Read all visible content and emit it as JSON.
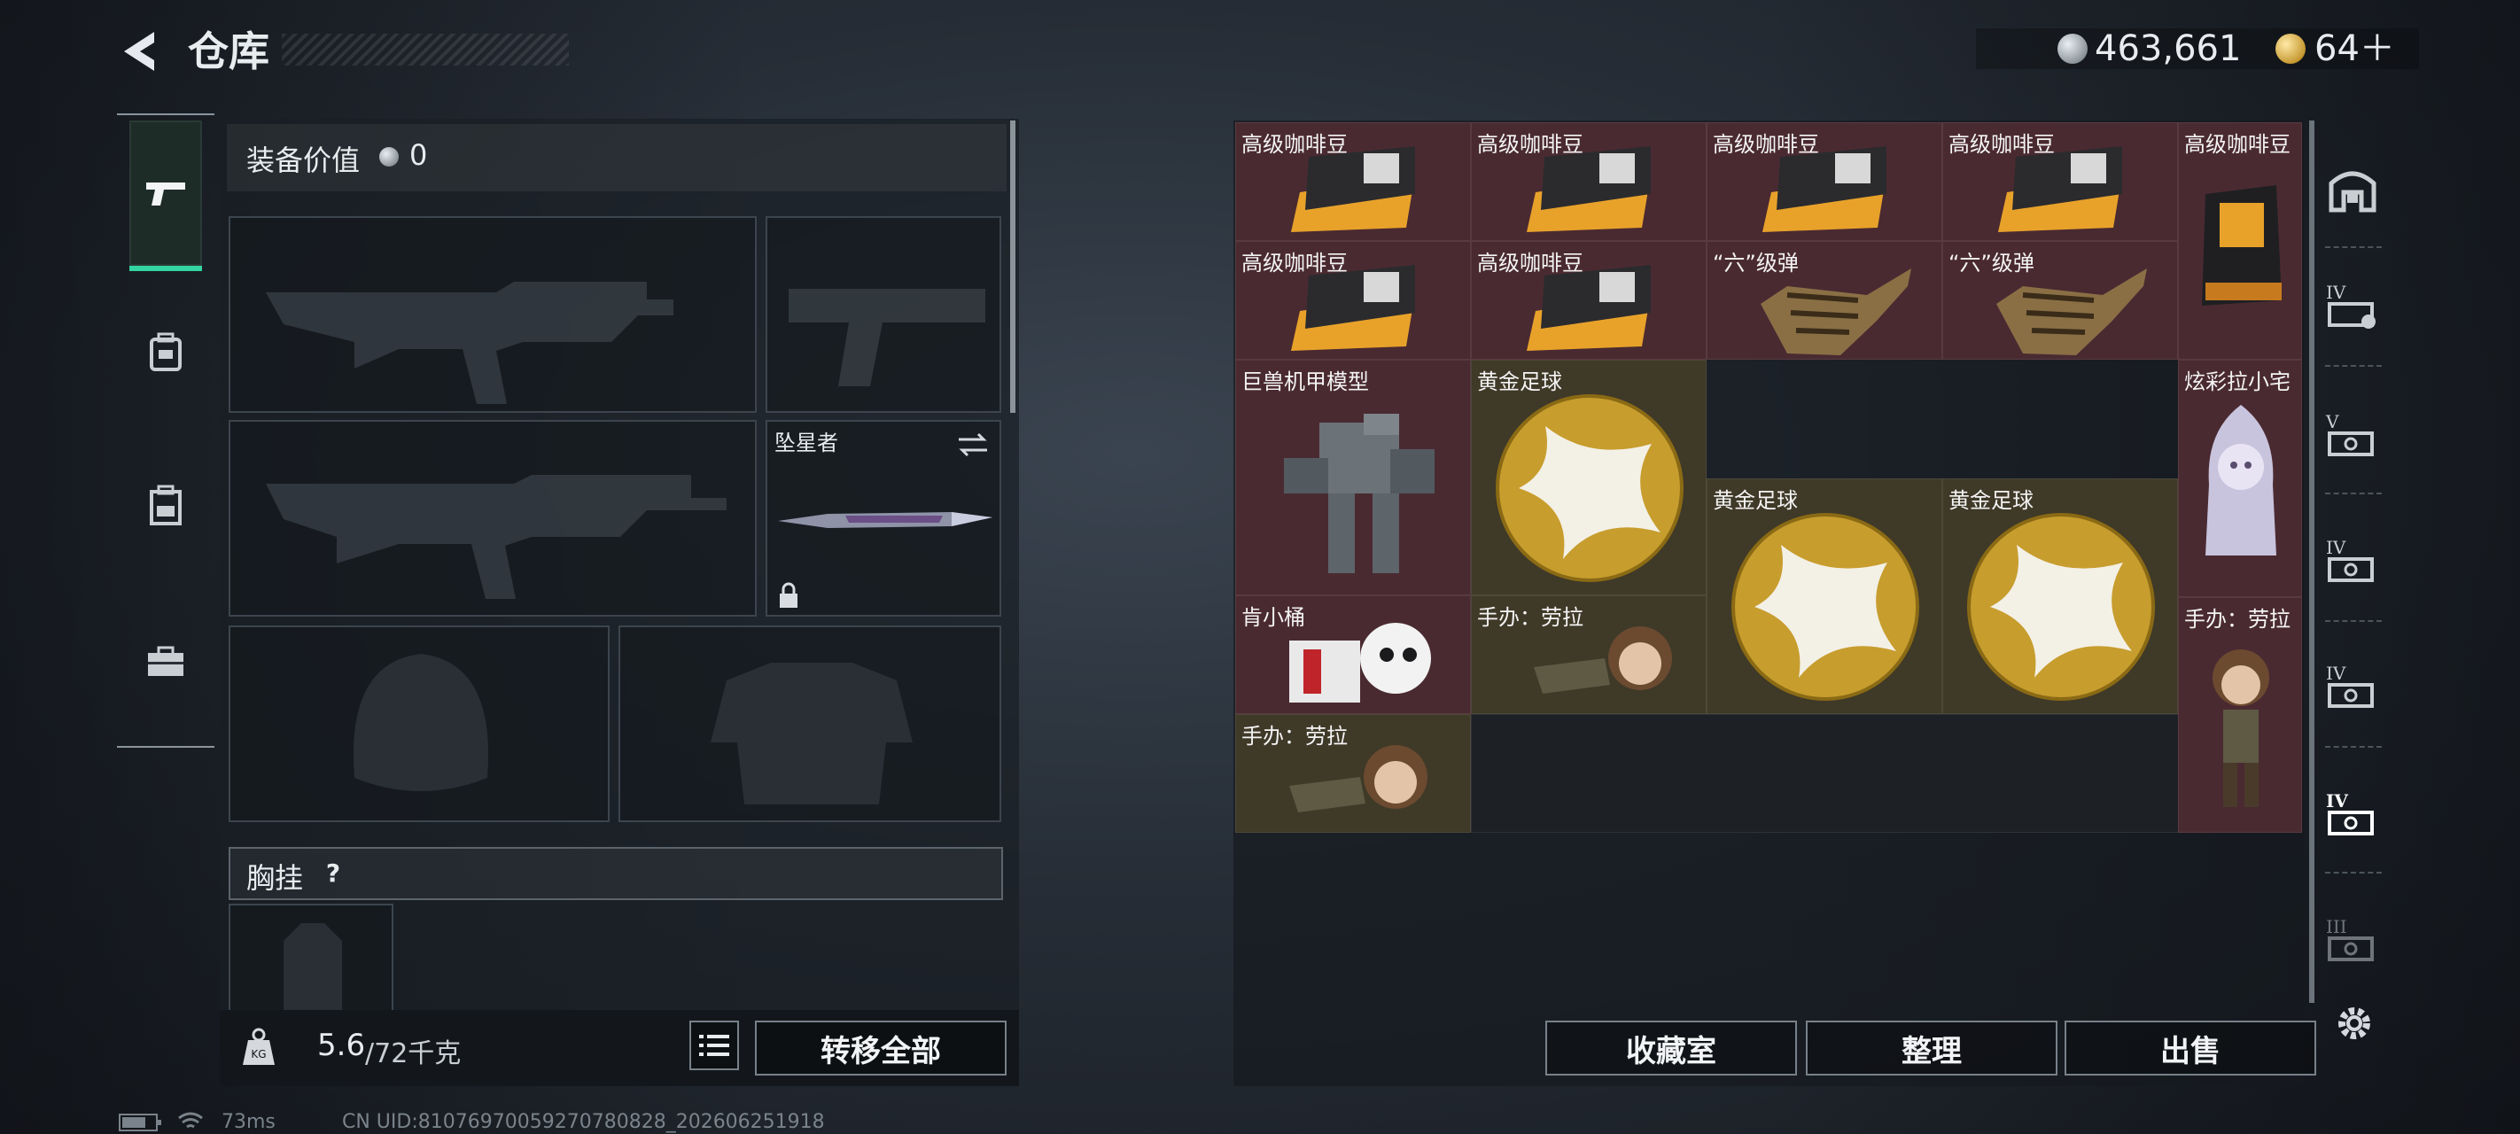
{
  "header": {
    "title": "仓库",
    "currency_silver": "463,661",
    "currency_gold": "64＋"
  },
  "tabs": [
    {
      "name": "weapons",
      "icon": "pistol-icon"
    },
    {
      "name": "armor",
      "icon": "backpack-icon"
    },
    {
      "name": "vest",
      "icon": "vest-icon"
    },
    {
      "name": "case",
      "icon": "toolbox-icon"
    }
  ],
  "equipment": {
    "value_label": "装备价值",
    "value": "0",
    "melee_name": "坠星者",
    "chest_label": "胸挂",
    "help": "?",
    "weight_current": "5.6",
    "weight_max": "/72千克",
    "transfer_all": "转移全部"
  },
  "storage": {
    "items": [
      {
        "name": "高级咖啡豆"
      },
      {
        "name": "高级咖啡豆"
      },
      {
        "name": "高级咖啡豆"
      },
      {
        "name": "高级咖啡豆"
      },
      {
        "name": "高级咖啡豆"
      },
      {
        "name": "高级咖啡豆"
      },
      {
        "name": "高级咖啡豆"
      },
      {
        "name": "“六”级弹"
      },
      {
        "name": "“六”级弹"
      },
      {
        "name": "巨兽机甲模型"
      },
      {
        "name": "黄金足球"
      },
      {
        "name": "炫彩拉小宅"
      },
      {
        "name": "黄金足球"
      },
      {
        "name": "黄金足球"
      },
      {
        "name": "肯小桶"
      },
      {
        "name": "手办：劳拉"
      },
      {
        "name": "手办：劳拉"
      },
      {
        "name": "手办：劳拉"
      }
    ],
    "buttons": {
      "collection": "收藏室",
      "organize": "整理",
      "sell": "出售"
    },
    "rail": [
      "vault-icon",
      "IV",
      "V",
      "IV",
      "IV",
      "IV",
      "III"
    ]
  },
  "status": {
    "ping": "73ms",
    "uid": "CN UID:81076970059270780828_202606251918"
  }
}
